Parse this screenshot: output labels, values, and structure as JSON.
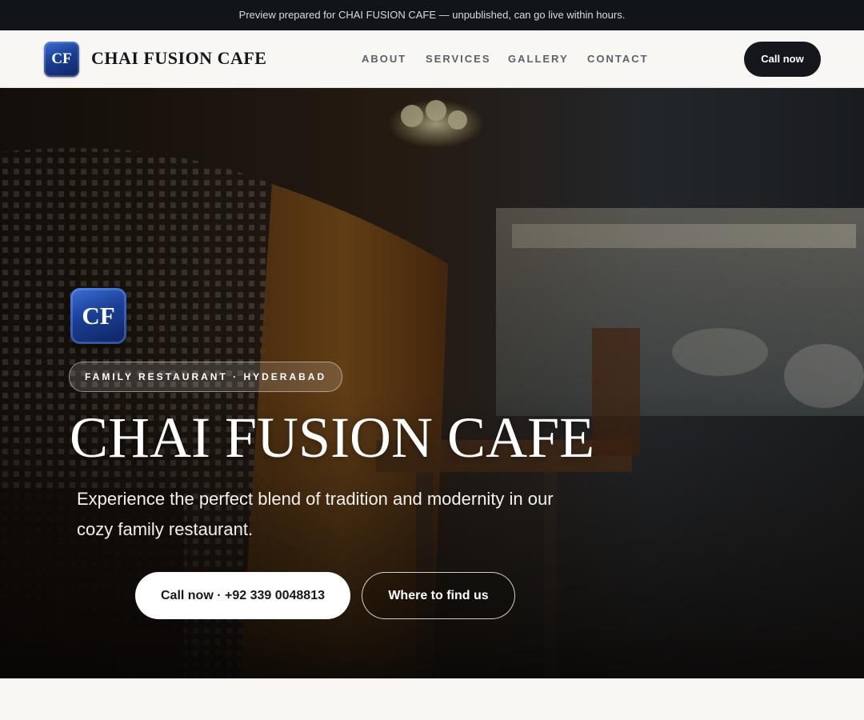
{
  "preview_bar": {
    "text": "Preview prepared for CHAI FUSION CAFE — unpublished, can go live within hours."
  },
  "header": {
    "logo_text": "CF",
    "brand_name": "CHAI FUSION CAFE",
    "nav": [
      {
        "label": "ABOUT"
      },
      {
        "label": "SERVICES"
      },
      {
        "label": "GALLERY"
      },
      {
        "label": "CONTACT"
      }
    ],
    "cta_label": "Call now"
  },
  "hero": {
    "logo_text": "CF",
    "tag": "FAMILY RESTAURANT · HYDERABAD",
    "title": "CHAI FUSION CAFE",
    "subtitle": "Experience the perfect blend of tradition and modernity in our cozy family restaurant.",
    "primary_button": "Call now · +92 339 0048813",
    "secondary_button": "Where to find us",
    "background_image": "blurred-restaurant-interior"
  },
  "colors": {
    "dark": "#15171c",
    "preview_bar_bg": "#111418",
    "brand_blue": "#1b3f95",
    "page_bg": "#f8f7f4"
  }
}
